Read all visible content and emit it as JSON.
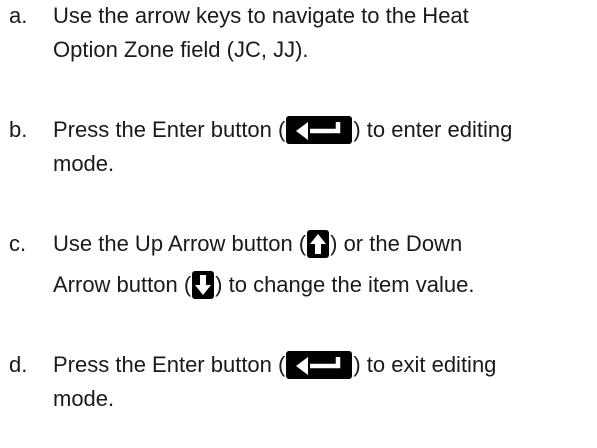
{
  "steps": [
    {
      "marker": "a.",
      "line1": "Use the arrow keys to navigate to the Heat",
      "line2": "Option Zone field (JC, JJ)."
    },
    {
      "marker": "b.",
      "line1_pre": "Press the Enter button (",
      "line1_post": ") to enter editing",
      "line2": "mode.",
      "icon": "enter-key-icon"
    },
    {
      "marker": "c.",
      "line1_pre": "Use the Up Arrow button (",
      "line1_post": ") or the Down",
      "line2_pre": "Arrow button (",
      "line2_post": ") to change the item value.",
      "icon1": "up-arrow-key-icon",
      "icon2": "down-arrow-key-icon"
    },
    {
      "marker": "d.",
      "line1_pre": "Press the Enter button (",
      "line1_post": ") to exit editing",
      "line2": "mode.",
      "icon": "enter-key-icon"
    }
  ]
}
